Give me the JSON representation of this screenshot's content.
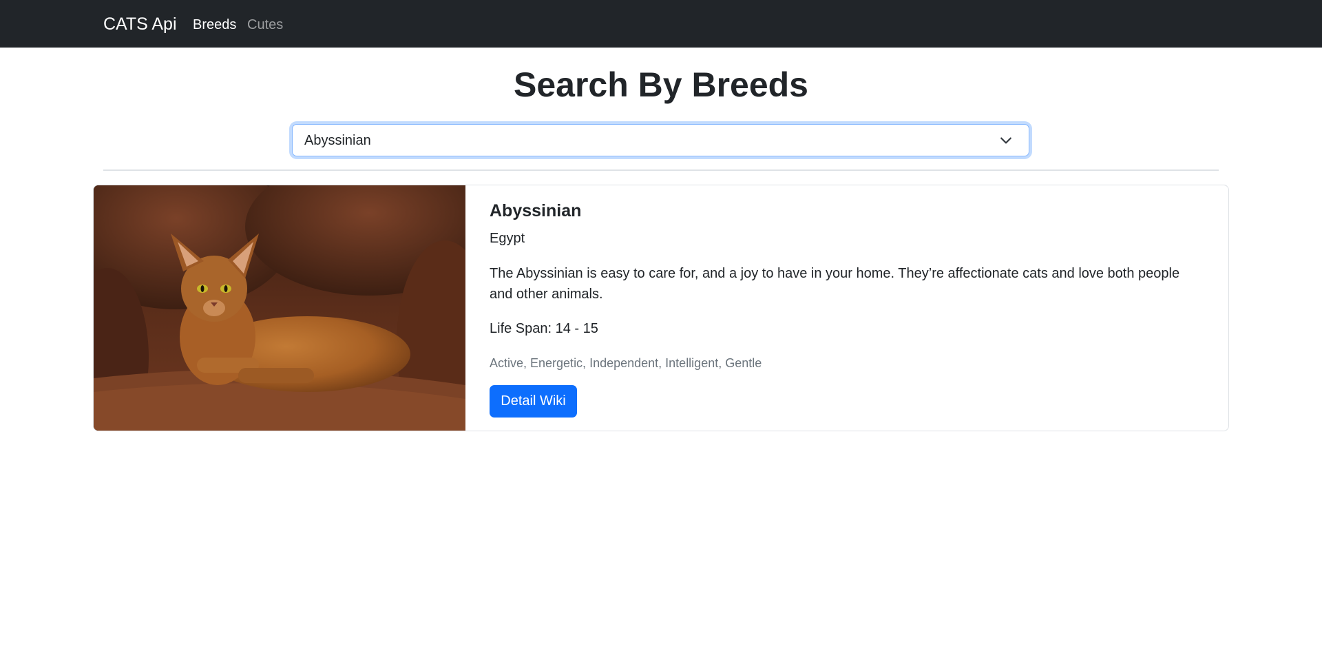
{
  "navbar": {
    "brand": "CATS Api",
    "links": [
      {
        "label": "Breeds",
        "active": true
      },
      {
        "label": "Cutes",
        "active": false
      }
    ],
    "background_color": "#212529"
  },
  "page": {
    "title": "Search By Breeds"
  },
  "breed_select": {
    "selected_value": "Abyssinian",
    "icon": "chevron-down-icon",
    "focus_color": "#86b7fe"
  },
  "breed_card": {
    "image_alt": "cat-photo",
    "name": "Abyssinian",
    "origin": "Egypt",
    "description": "The Abyssinian is easy to care for, and a joy to have in your home. They’re affectionate cats and love both people and other animals.",
    "life_span": "Life Span: 14 - 15",
    "temperament": "Active, Energetic, Independent, Intelligent, Gentle",
    "button_label": "Detail Wiki",
    "button_color": "#0d6efd"
  }
}
